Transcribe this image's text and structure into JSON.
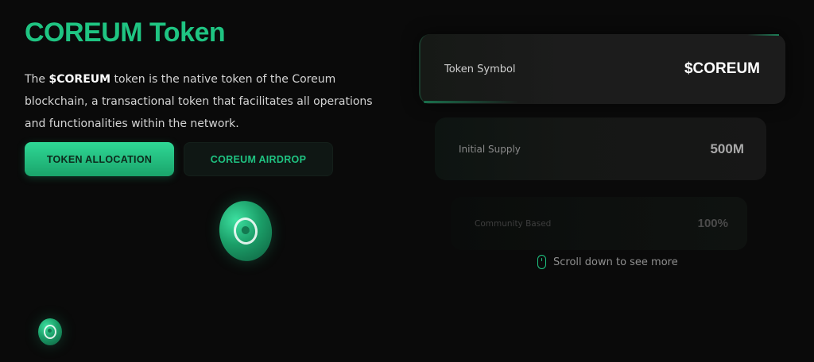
{
  "header": {
    "title": "COREUM Token"
  },
  "description": {
    "prefix": "The ",
    "token": "$COREUM",
    "suffix": " token is the native token of the Coreum blockchain, a transactional token that facilitates all operations and functionalities within the network."
  },
  "buttons": {
    "token_allocation": "TOKEN ALLOCATION",
    "coreum_airdrop": "COREUM AIRDROP"
  },
  "cards": [
    {
      "label": "Token Symbol",
      "value": "$COREUM"
    },
    {
      "label": "Initial Supply",
      "value": "500M"
    },
    {
      "label": "Community Based",
      "value": "100%"
    }
  ],
  "scroll_hint": {
    "text": "Scroll down to see more",
    "icon": "mouse-icon"
  },
  "colors": {
    "accent": "#1fc482",
    "background": "#0a0a0a"
  },
  "icons": {
    "coin_large": "coreum-coin-icon",
    "coin_small": "coreum-coin-icon"
  }
}
